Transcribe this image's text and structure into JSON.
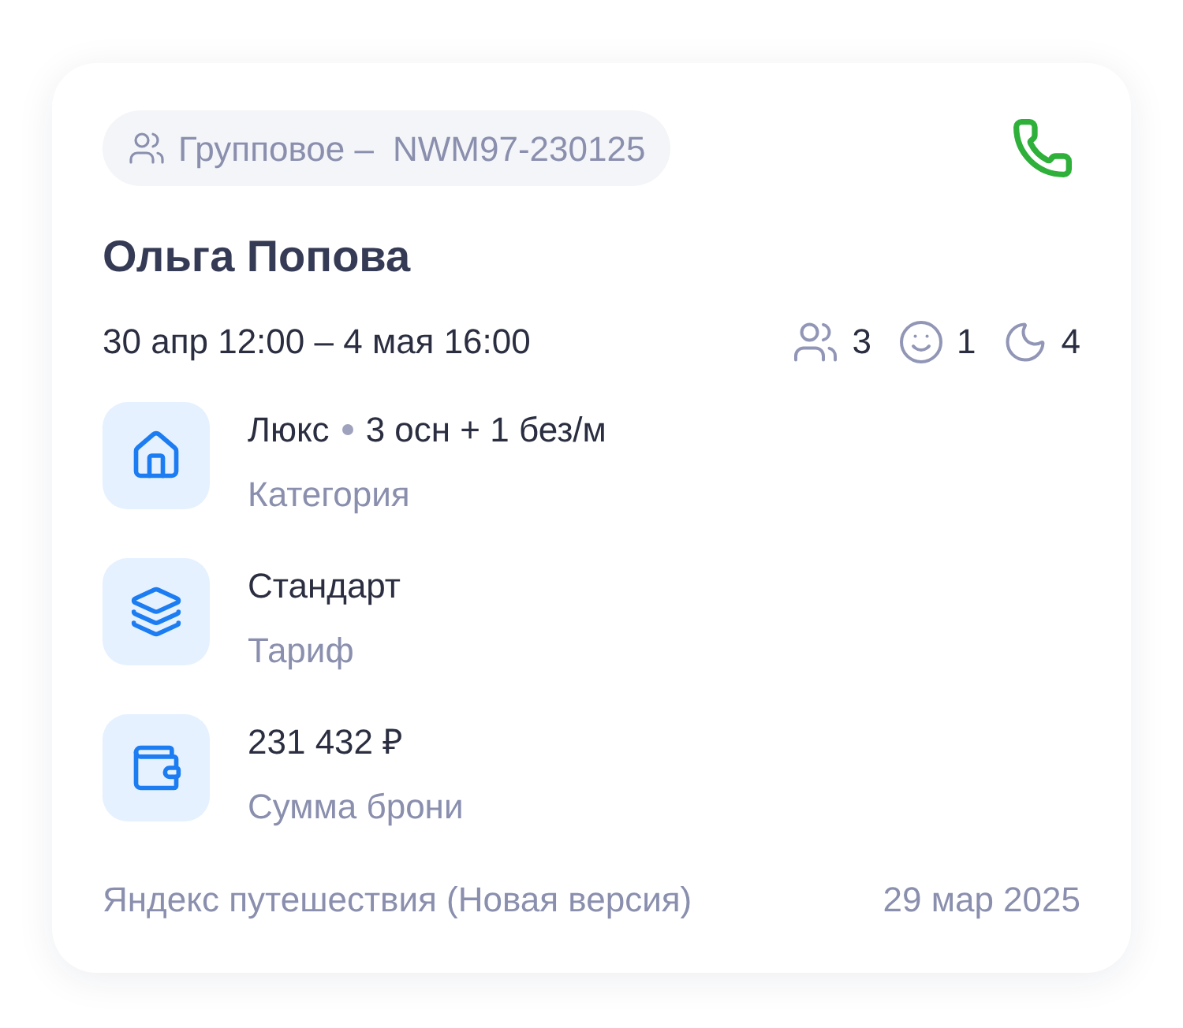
{
  "booking_badge": {
    "type": "Групповое –",
    "code": "NWM97-230125"
  },
  "guest_name": "Ольга Попова",
  "dates": "30 апр 12:00 – 4 мая 16:00",
  "counts": [
    {
      "kind": "adults",
      "value": "3"
    },
    {
      "kind": "children",
      "value": "1"
    },
    {
      "kind": "nights",
      "value": "4"
    }
  ],
  "details": [
    {
      "kind": "category",
      "value": "Люкс",
      "extra": "3 осн + 1 без/м",
      "label": "Категория"
    },
    {
      "kind": "tariff",
      "value": "Стандарт",
      "label": "Тариф"
    },
    {
      "kind": "amount",
      "value": "231 432 ₽",
      "label": "Сумма брони"
    }
  ],
  "footer": {
    "source": "Яндекс путешествия (Новая версия)",
    "date": "29 мар 2025"
  }
}
